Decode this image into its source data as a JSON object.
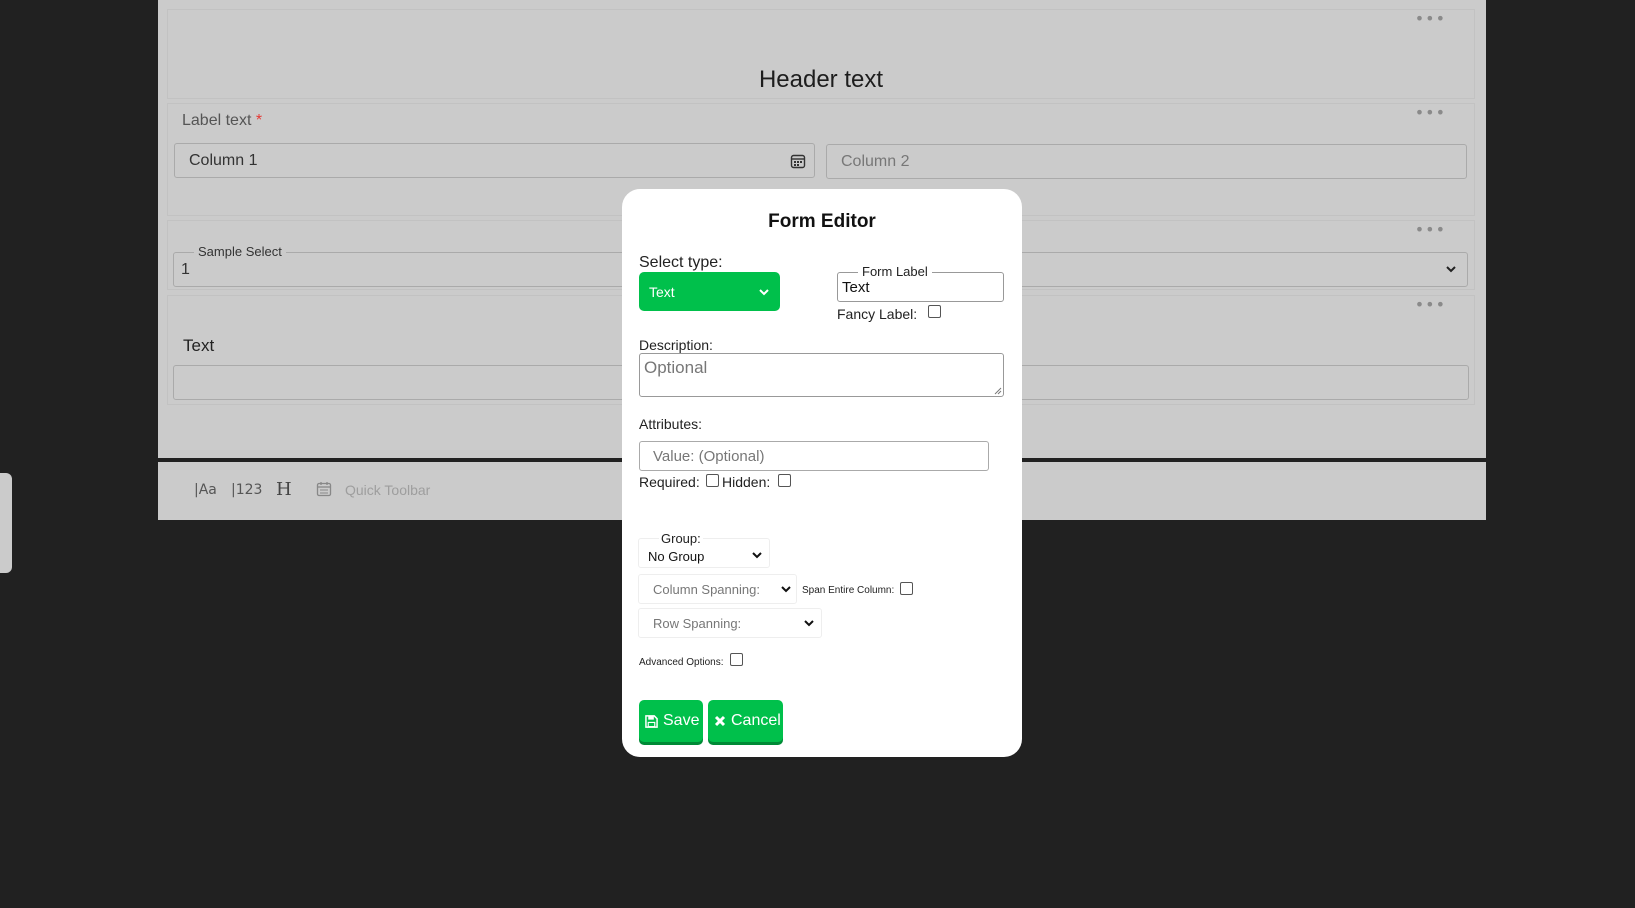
{
  "canvas": {
    "header_text": "Header text",
    "label_text": "Label text",
    "required_marker": "*",
    "column1_value": "Column 1",
    "column2_placeholder": "Column 2",
    "sample_select_legend": "Sample Select",
    "sample_select_value": "1",
    "text_label": "Text",
    "menu_glyph": "•••"
  },
  "toolbar": {
    "items": [
      "|Aa",
      "|123",
      "H"
    ],
    "quick_label": "Quick Toolbar"
  },
  "modal": {
    "title": "Form Editor",
    "select_type_label": "Select type:",
    "select_type_value": "Text",
    "form_label_legend": "Form Label",
    "form_label_value": "Text",
    "fancy_label": "Fancy Label:",
    "description_label": "Description:",
    "description_placeholder": "Optional",
    "attributes_label": "Attributes:",
    "value_placeholder": "Value: (Optional)",
    "required_label": "Required:",
    "hidden_label": "Hidden:",
    "group_legend": "Group:",
    "group_value": "No Group",
    "column_spanning": "Column Spanning:",
    "span_entire_column": "Span Entire Column:",
    "row_spanning": "Row Spanning:",
    "advanced_options": "Advanced Options:",
    "save_label": "Save",
    "cancel_label": "Cancel"
  },
  "colors": {
    "accent": "#00c04b",
    "backdrop": "#212121",
    "canvas": "#cbcbcb",
    "required": "#e53935"
  }
}
